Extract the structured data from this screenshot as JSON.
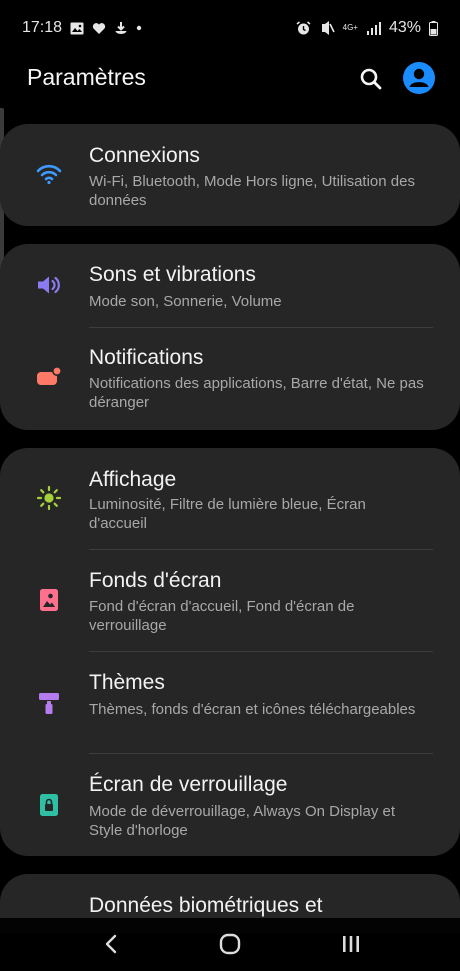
{
  "status_bar": {
    "time": "17:18",
    "battery_percent": "43%",
    "network_label": "4G+",
    "left_icons": [
      "gallery-icon",
      "heart-icon",
      "download-icon",
      "dot-icon"
    ],
    "right_icons": [
      "alarm-icon",
      "vibrate-icon",
      "network-icon",
      "signal-icon",
      "battery-icon"
    ]
  },
  "header": {
    "title": "Paramètres",
    "accent_color": "#1a8cff"
  },
  "sections": [
    {
      "items": [
        {
          "title": "Connexions",
          "subtitle": "Wi-Fi, Bluetooth, Mode Hors ligne, Utilisation des données",
          "icon": "wifi-icon",
          "color": "#3d9bff"
        }
      ]
    },
    {
      "items": [
        {
          "title": "Sons et vibrations",
          "subtitle": "Mode son, Sonnerie, Volume",
          "icon": "speaker-icon",
          "color": "#8a7cf0"
        },
        {
          "title": "Notifications",
          "subtitle": "Notifications des applications, Barre d'état, Ne pas déranger",
          "icon": "notification-icon",
          "color": "#ff7a66"
        }
      ]
    },
    {
      "items": [
        {
          "title": "Affichage",
          "subtitle": "Luminosité, Filtre de lumière bleue, Écran d'accueil",
          "icon": "brightness-icon",
          "color": "#a4d13a"
        },
        {
          "title": "Fonds d'écran",
          "subtitle": "Fond d'écran d'accueil, Fond d'écran de verrouillage",
          "icon": "wallpaper-icon",
          "color": "#ff6f8e"
        },
        {
          "title": "Thèmes",
          "subtitle": "Thèmes, fonds d'écran et icônes téléchargeables",
          "icon": "paint-roller-icon",
          "color": "#b57cf0"
        },
        {
          "title": "Écran de verrouillage",
          "subtitle": "Mode de déverrouillage, Always On Display et Style d'horloge",
          "icon": "lock-icon",
          "color": "#2fbfa5"
        }
      ]
    },
    {
      "items": [
        {
          "title": "Données biométriques et"
        }
      ]
    }
  ],
  "nav_bar": {
    "buttons": [
      "back-icon",
      "home-icon",
      "recent-apps-icon"
    ]
  }
}
